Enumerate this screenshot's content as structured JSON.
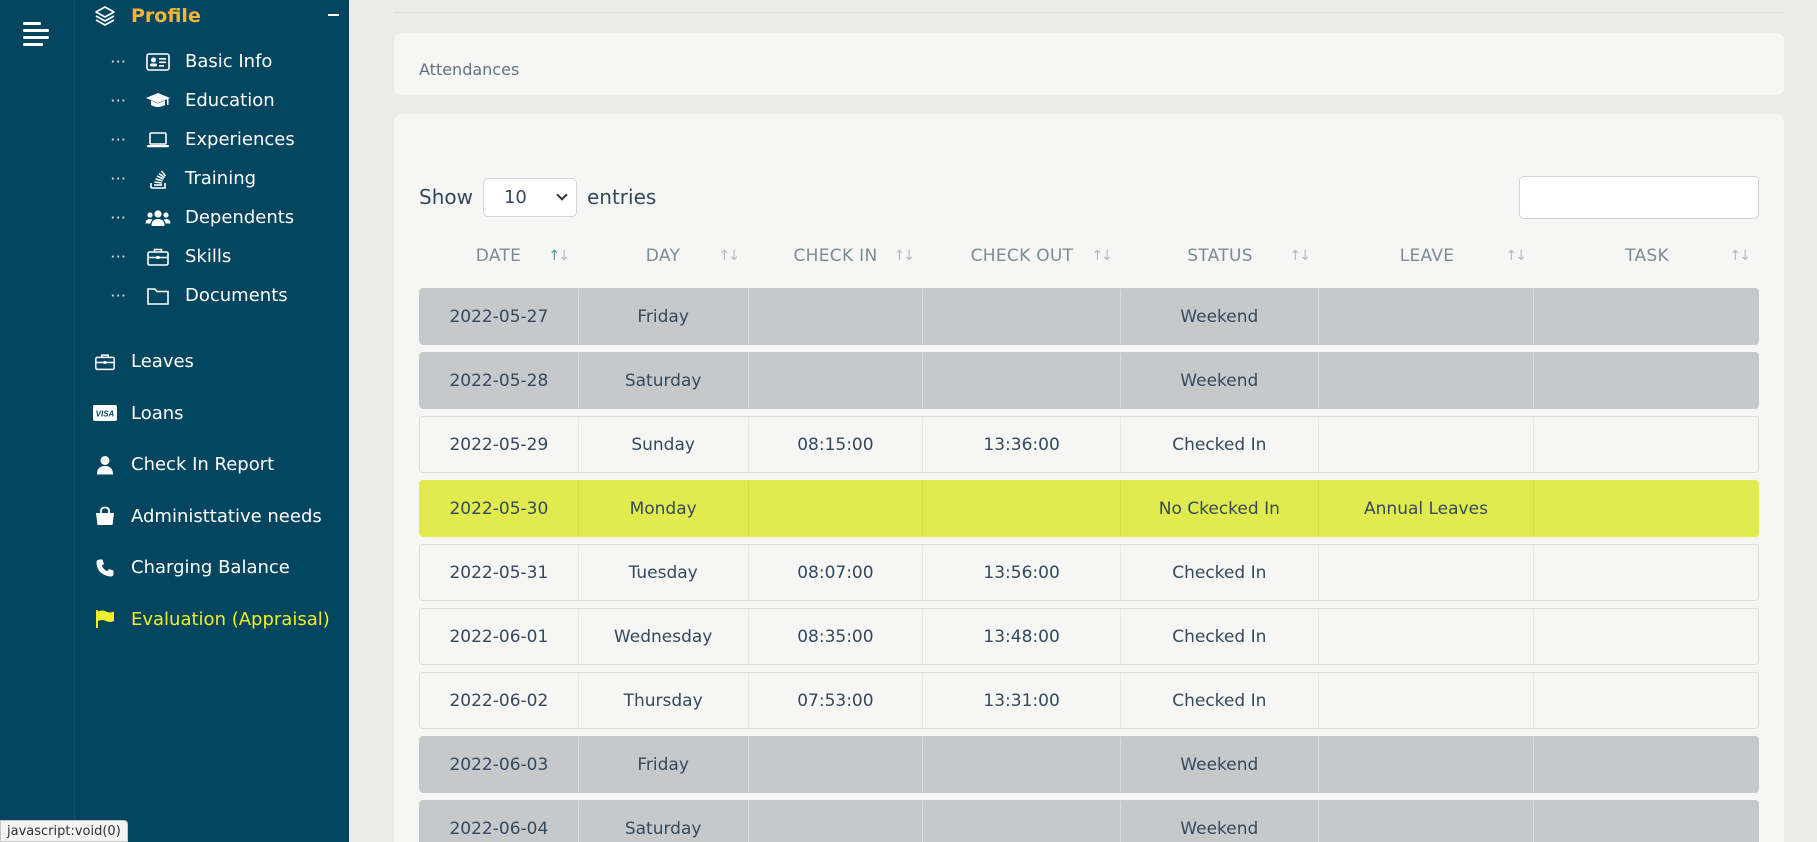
{
  "sidebar": {
    "profile": {
      "label": "Profile"
    },
    "sub_items": [
      {
        "label": "Basic Info",
        "icon": "id-card-icon"
      },
      {
        "label": "Education",
        "icon": "graduation-cap-icon"
      },
      {
        "label": "Experiences",
        "icon": "laptop-icon"
      },
      {
        "label": "Training",
        "icon": "stack-icon"
      },
      {
        "label": "Dependents",
        "icon": "users-icon"
      },
      {
        "label": "Skills",
        "icon": "briefcase-icon"
      },
      {
        "label": "Documents",
        "icon": "folder-icon"
      }
    ],
    "nav_items": [
      {
        "label": "Leaves",
        "icon": "briefcase-icon"
      },
      {
        "label": "Loans",
        "icon": "visa-card-icon"
      },
      {
        "label": "Check In Report",
        "icon": "user-icon"
      },
      {
        "label": "Administtative needs",
        "icon": "shopping-bag-icon"
      },
      {
        "label": "Charging Balance",
        "icon": "phone-icon"
      },
      {
        "label": "Evaluation (Appraisal)",
        "icon": "flag-icon",
        "active": true
      }
    ],
    "accent_color": "#f5b43a",
    "active_color": "#f0f028"
  },
  "status_bar": {
    "text": "javascript:void(0)"
  },
  "page": {
    "title": "Attendances"
  },
  "table_controls": {
    "show_label": "Show",
    "page_size": "10",
    "entries_label": "entries",
    "search_value": ""
  },
  "table": {
    "columns": [
      "DATE",
      "DAY",
      "CHECK IN",
      "CHECK OUT",
      "STATUS",
      "LEAVE",
      "TASK"
    ],
    "rows": [
      {
        "date": "2022-05-27",
        "day": "Friday",
        "check_in": "",
        "check_out": "",
        "status": "Weekend",
        "leave": "",
        "task": "",
        "type": "weekend"
      },
      {
        "date": "2022-05-28",
        "day": "Saturday",
        "check_in": "",
        "check_out": "",
        "status": "Weekend",
        "leave": "",
        "task": "",
        "type": "weekend"
      },
      {
        "date": "2022-05-29",
        "day": "Sunday",
        "check_in": "08:15:00",
        "check_out": "13:36:00",
        "status": "Checked In",
        "leave": "",
        "task": "",
        "type": "normal"
      },
      {
        "date": "2022-05-30",
        "day": "Monday",
        "check_in": "",
        "check_out": "",
        "status": "No Ckecked In",
        "leave": "Annual Leaves",
        "task": "",
        "type": "absent"
      },
      {
        "date": "2022-05-31",
        "day": "Tuesday",
        "check_in": "08:07:00",
        "check_out": "13:56:00",
        "status": "Checked In",
        "leave": "",
        "task": "",
        "type": "normal"
      },
      {
        "date": "2022-06-01",
        "day": "Wednesday",
        "check_in": "08:35:00",
        "check_out": "13:48:00",
        "status": "Checked In",
        "leave": "",
        "task": "",
        "type": "normal"
      },
      {
        "date": "2022-06-02",
        "day": "Thursday",
        "check_in": "07:53:00",
        "check_out": "13:31:00",
        "status": "Checked In",
        "leave": "",
        "task": "",
        "type": "normal"
      },
      {
        "date": "2022-06-03",
        "day": "Friday",
        "check_in": "",
        "check_out": "",
        "status": "Weekend",
        "leave": "",
        "task": "",
        "type": "weekend"
      },
      {
        "date": "2022-06-04",
        "day": "Saturday",
        "check_in": "",
        "check_out": "",
        "status": "Weekend",
        "leave": "",
        "task": "",
        "type": "weekend"
      }
    ],
    "row_colors": {
      "weekend": "#c6c9cc",
      "absent": "#e1eb4d",
      "normal": "#f6f6f4"
    }
  }
}
